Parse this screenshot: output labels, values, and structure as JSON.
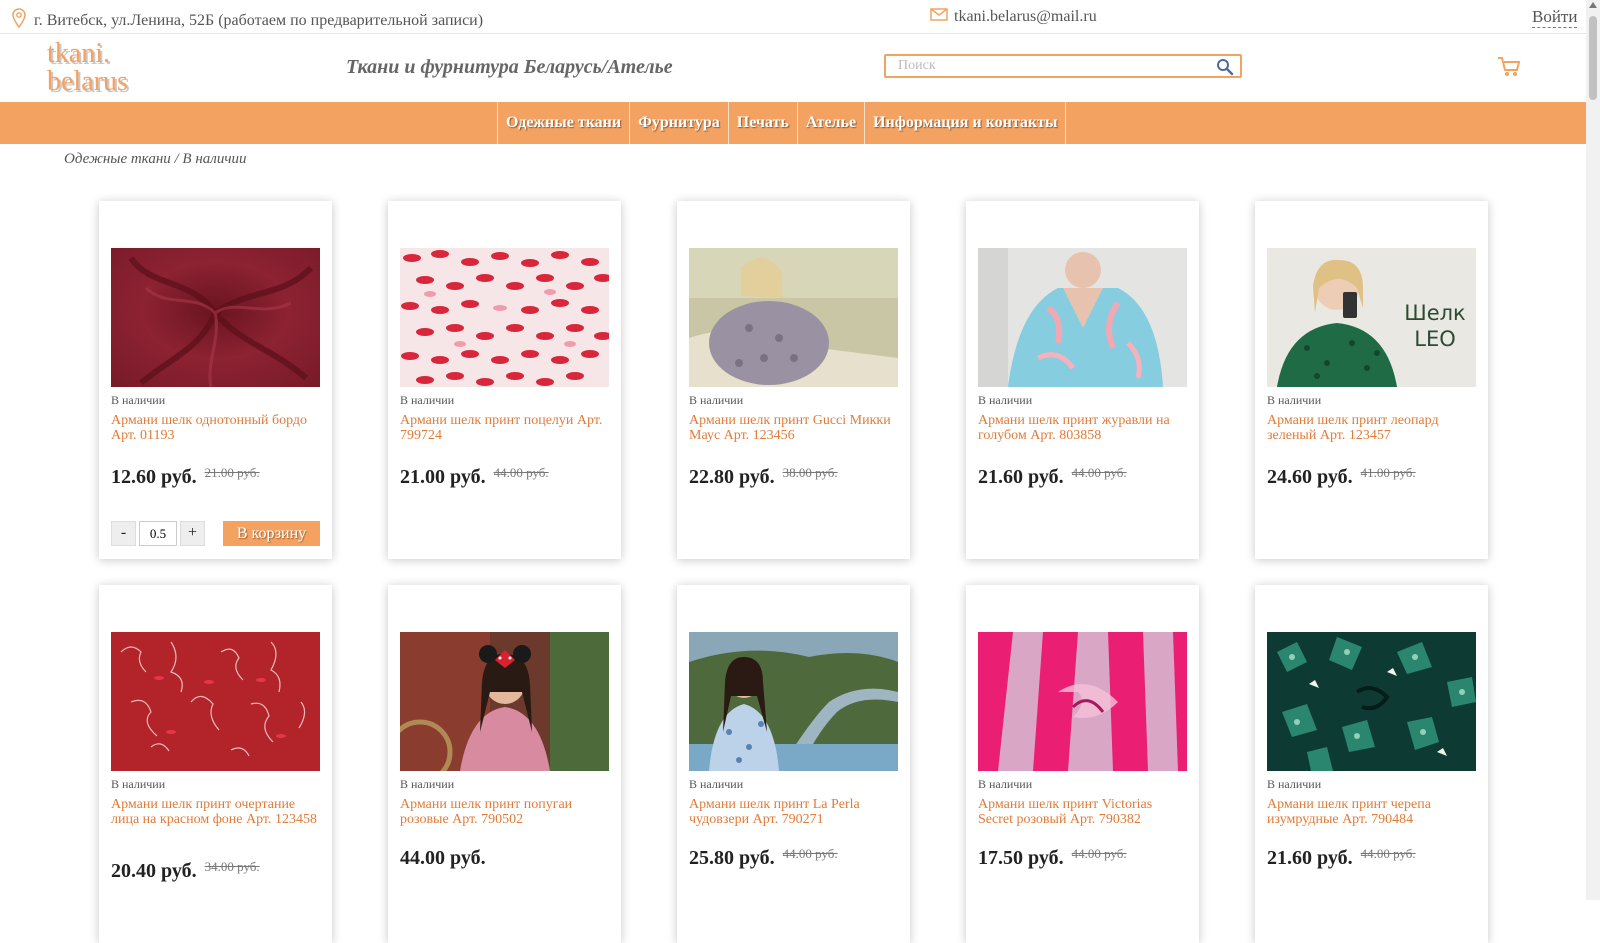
{
  "topbar": {
    "address": "г. Витебск, ул.Ленина, 52Б (работаем по предварительной записи)",
    "email": "tkani.belarus@mail.ru",
    "login": "Войти"
  },
  "header": {
    "logo_line1": "tkani.",
    "logo_line2": "belarus",
    "tagline": "Ткани и фурнитура Беларусь/Ателье",
    "search_placeholder": "Поиск"
  },
  "nav": [
    "Одежные ткани",
    "Фурнитура",
    "Печать",
    "Ателье",
    "Информация и контакты"
  ],
  "breadcrumb": "Одежные ткани / В наличии",
  "colors": {
    "accent": "#f4a261",
    "link": "#e07b39"
  },
  "products": [
    {
      "stock": "В наличии",
      "name": "Армани шелк однотонный бордо Арт. 01193",
      "price": "12.60 руб.",
      "old_price": "21.00 руб.",
      "qty": "0.5",
      "cart_label": "В корзину",
      "minus": "-",
      "plus": "+"
    },
    {
      "stock": "В наличии",
      "name": "Армани шелк принт поцелуи Арт. 799724",
      "price": "21.00 руб.",
      "old_price": "44.00 руб."
    },
    {
      "stock": "В наличии",
      "name": "Армани шелк принт Gucci Микки Маус Арт. 123456",
      "price": "22.80 руб.",
      "old_price": "38.00 руб."
    },
    {
      "stock": "В наличии",
      "name": "Армани шелк принт журавли на голубом Арт. 803858",
      "price": "21.60 руб.",
      "old_price": "44.00 руб."
    },
    {
      "stock": "В наличии",
      "name": "Армани шелк принт леопард зеленый Арт. 123457",
      "price": "24.60 руб.",
      "old_price": "41.00 руб.",
      "image_text_1": "Шелк",
      "image_text_2": "LEO"
    },
    {
      "stock": "В наличии",
      "name": "Армани шелк принт очертание лица на красном фоне Арт. 123458",
      "price": "20.40 руб.",
      "old_price": "34.00 руб."
    },
    {
      "stock": "В наличии",
      "name": "Армани шелк принт попугаи розовые Арт. 790502",
      "price": "44.00 руб.",
      "old_price": ""
    },
    {
      "stock": "В наличии",
      "name": "Армани шелк принт La Perla чудовзери Арт. 790271",
      "price": "25.80 руб.",
      "old_price": "44.00 руб."
    },
    {
      "stock": "В наличии",
      "name": "Армани шелк принт Victorias Secret розовый Арт. 790382",
      "price": "17.50 руб.",
      "old_price": "44.00 руб."
    },
    {
      "stock": "В наличии",
      "name": "Армани шелк принт черепа изумрудные Арт. 790484",
      "price": "21.60 руб.",
      "old_price": "44.00 руб."
    }
  ]
}
